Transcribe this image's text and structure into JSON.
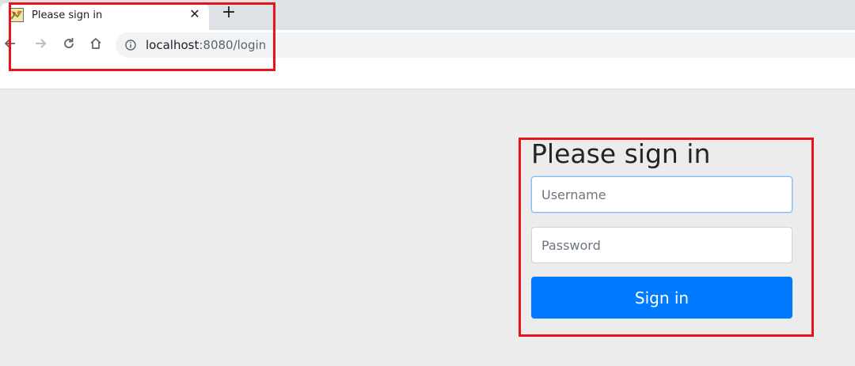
{
  "browser": {
    "tab_title": "Please sign in",
    "tab_close": "✕",
    "new_tab": "+",
    "url_host": "localhost",
    "url_path": ":8080/login",
    "icons": {
      "favicon": "app-favicon",
      "close": "close-icon",
      "new_tab": "plus-icon",
      "back": "arrow-left-icon",
      "forward": "arrow-right-icon",
      "reload": "reload-icon",
      "home": "home-icon",
      "site_info": "info-icon"
    }
  },
  "login": {
    "heading": "Please sign in",
    "username_placeholder": "Username",
    "password_placeholder": "Password",
    "submit_label": "Sign in"
  },
  "colors": {
    "primary": "#007bff",
    "page_background": "#ececec",
    "annotation": "#e8141b"
  }
}
